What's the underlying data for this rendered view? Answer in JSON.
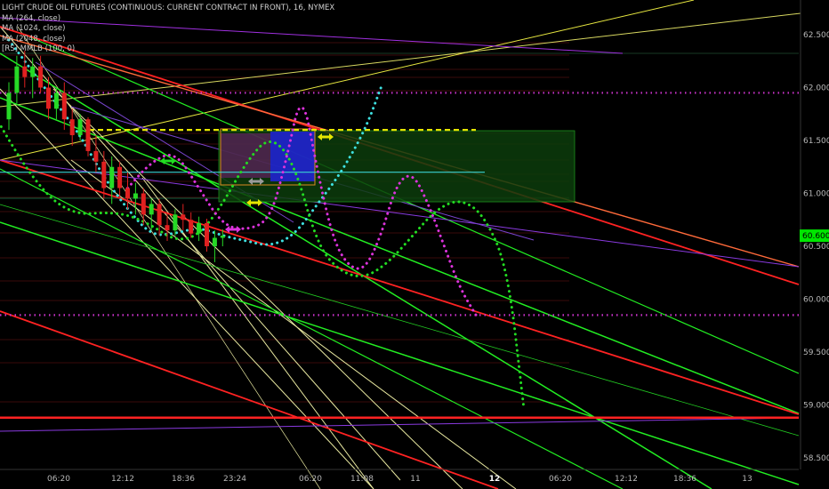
{
  "chart_data": {
    "type": "candlestick",
    "title": "LIGHT CRUDE OIL FUTURES (CONTINUOUS: CURRENT CONTRACT IN FRONT), 16, NYMEX",
    "legend": [
      "MA (264, close)",
      "MA (1024, close)",
      "MA (2048, close)",
      "[RS] MMLB (100, 0)"
    ],
    "y_axis": {
      "side": "right",
      "ticks": [
        "62.500",
        "62.000",
        "61.500",
        "61.000",
        "60.500",
        "60.000",
        "59.500",
        "59.000",
        "58.500"
      ],
      "tick_values": [
        62.5,
        62.0,
        61.5,
        61.0,
        60.5,
        60.0,
        59.5,
        59.0,
        58.5
      ],
      "range": [
        58.38,
        62.75
      ]
    },
    "x_axis": {
      "ticks": [
        "06:20",
        "12:12",
        "18:36",
        "23:24",
        "06:20",
        "11:08",
        "11",
        "12",
        "06:20",
        "12:12",
        "18:36",
        "13"
      ],
      "bold_ticks": [
        "12"
      ]
    },
    "current_price": {
      "label": "60.600",
      "value": 60.6,
      "color": "#00e600"
    },
    "candles": [
      {
        "o": 61.7,
        "h": 62.05,
        "l": 61.6,
        "c": 61.95
      },
      {
        "o": 61.95,
        "h": 62.3,
        "l": 61.85,
        "c": 62.2
      },
      {
        "o": 62.2,
        "h": 62.35,
        "l": 62.0,
        "c": 62.1
      },
      {
        "o": 62.1,
        "h": 62.28,
        "l": 61.9,
        "c": 62.2
      },
      {
        "o": 62.2,
        "h": 62.3,
        "l": 61.95,
        "c": 62.0
      },
      {
        "o": 62.0,
        "h": 62.1,
        "l": 61.7,
        "c": 61.8
      },
      {
        "o": 61.8,
        "h": 62.0,
        "l": 61.7,
        "c": 61.95
      },
      {
        "o": 61.95,
        "h": 62.05,
        "l": 61.6,
        "c": 61.7
      },
      {
        "o": 61.7,
        "h": 61.8,
        "l": 61.45,
        "c": 61.55
      },
      {
        "o": 61.55,
        "h": 61.75,
        "l": 61.5,
        "c": 61.7
      },
      {
        "o": 61.7,
        "h": 61.72,
        "l": 61.35,
        "c": 61.4
      },
      {
        "o": 61.4,
        "h": 61.55,
        "l": 61.2,
        "c": 61.3
      },
      {
        "o": 61.3,
        "h": 61.4,
        "l": 60.95,
        "c": 61.05
      },
      {
        "o": 61.05,
        "h": 61.35,
        "l": 60.9,
        "c": 61.25
      },
      {
        "o": 61.25,
        "h": 61.3,
        "l": 60.95,
        "c": 61.05
      },
      {
        "o": 61.05,
        "h": 61.2,
        "l": 60.85,
        "c": 60.95
      },
      {
        "o": 60.95,
        "h": 61.1,
        "l": 60.8,
        "c": 61.0
      },
      {
        "o": 61.0,
        "h": 61.05,
        "l": 60.7,
        "c": 60.8
      },
      {
        "o": 60.8,
        "h": 60.95,
        "l": 60.65,
        "c": 60.9
      },
      {
        "o": 60.9,
        "h": 60.95,
        "l": 60.6,
        "c": 60.7
      },
      {
        "o": 60.7,
        "h": 60.8,
        "l": 60.55,
        "c": 60.65
      },
      {
        "o": 60.65,
        "h": 60.85,
        "l": 60.6,
        "c": 60.8
      },
      {
        "o": 60.8,
        "h": 60.9,
        "l": 60.65,
        "c": 60.75
      },
      {
        "o": 60.75,
        "h": 60.82,
        "l": 60.58,
        "c": 60.62
      },
      {
        "o": 60.62,
        "h": 60.78,
        "l": 60.55,
        "c": 60.72
      },
      {
        "o": 60.72,
        "h": 60.76,
        "l": 60.45,
        "c": 60.5
      },
      {
        "o": 60.5,
        "h": 60.65,
        "l": 60.35,
        "c": 60.58
      },
      {
        "o": 60.58,
        "h": 60.66,
        "l": 60.5,
        "c": 60.6
      }
    ],
    "series": [
      {
        "style": "dotted",
        "color": "#3ee0e0",
        "points": [
          [
            0,
            62.45
          ],
          [
            3,
            62.15
          ],
          [
            6,
            61.85
          ],
          [
            9,
            61.55
          ],
          [
            12,
            61.15
          ],
          [
            15,
            60.85
          ],
          [
            18,
            60.6
          ],
          [
            21,
            60.62
          ],
          [
            24,
            60.68
          ],
          [
            27,
            60.6
          ],
          [
            30,
            60.55
          ],
          [
            33,
            60.5
          ],
          [
            36,
            60.6
          ],
          [
            39,
            60.9
          ],
          [
            42,
            61.2
          ],
          [
            45,
            61.6
          ],
          [
            47,
            62.0
          ]
        ]
      },
      {
        "style": "dotted",
        "color": "#22dd22",
        "points": [
          [
            -3,
            61.9
          ],
          [
            0,
            61.5
          ],
          [
            3,
            61.15
          ],
          [
            6,
            60.9
          ],
          [
            9,
            60.8
          ],
          [
            12,
            60.82
          ],
          [
            15,
            60.8
          ],
          [
            18,
            60.7
          ],
          [
            21,
            60.55
          ],
          [
            24,
            60.6
          ],
          [
            27,
            60.9
          ],
          [
            30,
            61.3
          ],
          [
            33,
            61.55
          ],
          [
            36,
            61.3
          ],
          [
            39,
            60.5
          ],
          [
            42,
            60.25
          ],
          [
            45,
            60.2
          ],
          [
            48,
            60.35
          ],
          [
            51,
            60.6
          ],
          [
            54,
            60.85
          ],
          [
            57,
            60.95
          ],
          [
            60,
            60.8
          ],
          [
            63,
            60.3
          ],
          [
            65,
            59.0
          ]
        ]
      },
      {
        "style": "dotted",
        "color": "#dd33dd",
        "points": [
          [
            15,
            61.05
          ],
          [
            18,
            61.3
          ],
          [
            21,
            61.4
          ],
          [
            24,
            61.05
          ],
          [
            27,
            60.7
          ],
          [
            30,
            60.65
          ],
          [
            33,
            60.75
          ],
          [
            35,
            61.3
          ],
          [
            37,
            62.0
          ],
          [
            39,
            61.2
          ],
          [
            41,
            60.55
          ],
          [
            43,
            60.3
          ],
          [
            45,
            60.28
          ],
          [
            47,
            60.6
          ],
          [
            49,
            61.1
          ],
          [
            51,
            61.2
          ],
          [
            53,
            60.9
          ],
          [
            55,
            60.5
          ],
          [
            57,
            60.1
          ],
          [
            59,
            59.85
          ]
        ]
      }
    ],
    "horizontal_levels": [
      {
        "value": 61.95,
        "color": "#cc33cc",
        "style": "dotted"
      },
      {
        "value": 59.85,
        "color": "#cc33cc",
        "style": "dotted"
      },
      {
        "value": 61.6,
        "color": "#e6e600",
        "style": "dashed"
      },
      {
        "value": 61.2,
        "color": "#3ad0d0",
        "style": "solid"
      },
      {
        "value": 58.88,
        "color": "#ff2222",
        "style": "solid"
      }
    ],
    "grid": true,
    "legend_position": "top-left"
  }
}
